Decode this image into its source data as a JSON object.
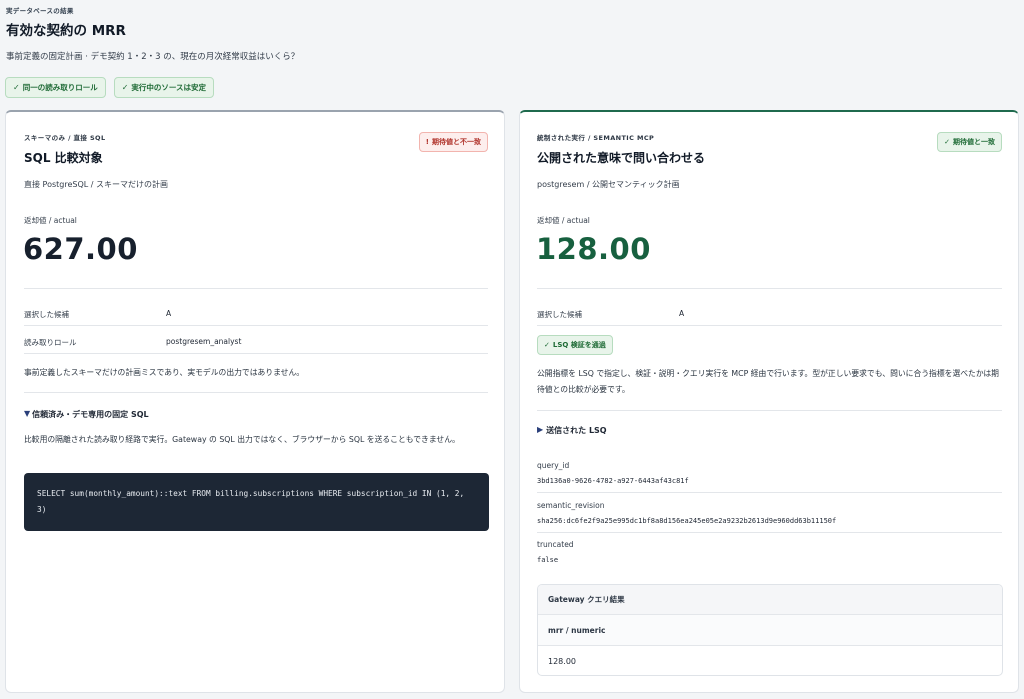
{
  "header": {
    "eyebrow": "実データベースの結果",
    "title": "有効な契約の MRR",
    "question": "事前定義の固定計画 · デモ契約 1・2・3 の、現在の月次経常収益はいくら？"
  },
  "chips": [
    {
      "icon": "check-icon",
      "label": "同一の読み取りロール"
    },
    {
      "icon": "check-icon",
      "label": "実行中のソースは安定"
    }
  ],
  "left_panel": {
    "eyebrow": "スキーマのみ / 直接 SQL",
    "title": "SQL 比較対象",
    "subtitle": "直接 PostgreSQL / スキーマだけの計画",
    "badge": {
      "icon": "exclamation-icon",
      "label": "期待値と不一致"
    },
    "return_label": "返却値 / actual",
    "value": "627.00",
    "rows": [
      {
        "key": "選択した候補",
        "value": "A"
      },
      {
        "key": "読み取りロール",
        "value": "postgresem_analyst"
      }
    ],
    "note": "事前定義したスキーマだけの計画ミスであり、実モデルの出力ではありません。",
    "sql_section": {
      "heading": "信頼済み・デモ専用の固定 SQL",
      "description": "比較用の隔離された読み取り経路で実行。Gateway の SQL 出力ではなく、ブラウザーから SQL を送ることもできません。",
      "code": "SELECT sum(monthly_amount)::text FROM billing.subscriptions WHERE subscription_id IN (1, 2, 3)"
    },
    "colors": {
      "accent": "#9aa3ae",
      "value": "#17202d",
      "badge": "#b0322a"
    }
  },
  "right_panel": {
    "eyebrow": "統制された実行 / SEMANTIC MCP",
    "title": "公開された意味で問い合わせる",
    "subtitle": "postgresem / 公開セマンティック計画",
    "badge": {
      "icon": "check-icon",
      "label": "期待値と一致"
    },
    "return_label": "返却値 / actual",
    "value": "128.00",
    "rows": [
      {
        "key": "選択した候補",
        "value": "A"
      }
    ],
    "lsq_badge": {
      "icon": "check-icon",
      "label": "LSQ 検証を通過"
    },
    "note": "公開指標を LSQ で指定し、検証・説明・クエリ実行を MCP 経由で行います。型が正しい要求でも、問いに合う指標を選べたかは期待値との比較が必要です。",
    "lsq_section": {
      "heading": "送信された LSQ",
      "fields": [
        {
          "key": "query_id",
          "value": "3bd136a0-9626-4782-a927-6443af43c81f"
        },
        {
          "key": "semantic_revision",
          "value": "sha256:dc6fe2f9a25e995dc1bf8a8d156ea245e05e2a9232b2613d9e960dd63b11150f"
        },
        {
          "key": "truncated",
          "value": "false"
        }
      ]
    },
    "result": {
      "heading": "Gateway クエリ結果",
      "column": "mrr / numeric",
      "cell": "128.00"
    },
    "colors": {
      "accent": "#1f6a4d",
      "value": "#17603f",
      "badge": "#1f6b36"
    }
  }
}
